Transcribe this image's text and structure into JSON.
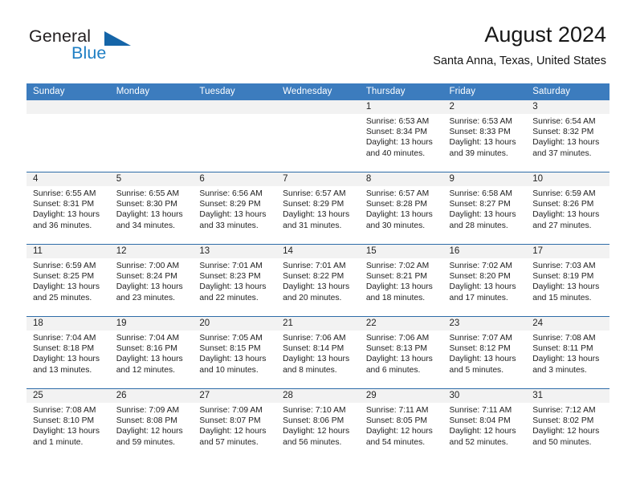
{
  "brand": {
    "name_part1": "General",
    "name_part2": "Blue",
    "triangle_color": "#1565a8",
    "blue_color": "#1f7fc4"
  },
  "header": {
    "title": "August 2024",
    "subtitle": "Santa Anna, Texas, United States"
  },
  "theme": {
    "header_row_bg": "#3c7cbe",
    "day_band_bg": "#f2f2f2",
    "row_divider": "#2e6ca8",
    "text": "#222222"
  },
  "weekdays": [
    "Sunday",
    "Monday",
    "Tuesday",
    "Wednesday",
    "Thursday",
    "Friday",
    "Saturday"
  ],
  "weeks": [
    [
      {
        "day": "",
        "sunrise": "",
        "sunset": "",
        "daylight_line1": "",
        "daylight_line2": ""
      },
      {
        "day": "",
        "sunrise": "",
        "sunset": "",
        "daylight_line1": "",
        "daylight_line2": ""
      },
      {
        "day": "",
        "sunrise": "",
        "sunset": "",
        "daylight_line1": "",
        "daylight_line2": ""
      },
      {
        "day": "",
        "sunrise": "",
        "sunset": "",
        "daylight_line1": "",
        "daylight_line2": ""
      },
      {
        "day": "1",
        "sunrise": "Sunrise: 6:53 AM",
        "sunset": "Sunset: 8:34 PM",
        "daylight_line1": "Daylight: 13 hours",
        "daylight_line2": "and 40 minutes."
      },
      {
        "day": "2",
        "sunrise": "Sunrise: 6:53 AM",
        "sunset": "Sunset: 8:33 PM",
        "daylight_line1": "Daylight: 13 hours",
        "daylight_line2": "and 39 minutes."
      },
      {
        "day": "3",
        "sunrise": "Sunrise: 6:54 AM",
        "sunset": "Sunset: 8:32 PM",
        "daylight_line1": "Daylight: 13 hours",
        "daylight_line2": "and 37 minutes."
      }
    ],
    [
      {
        "day": "4",
        "sunrise": "Sunrise: 6:55 AM",
        "sunset": "Sunset: 8:31 PM",
        "daylight_line1": "Daylight: 13 hours",
        "daylight_line2": "and 36 minutes."
      },
      {
        "day": "5",
        "sunrise": "Sunrise: 6:55 AM",
        "sunset": "Sunset: 8:30 PM",
        "daylight_line1": "Daylight: 13 hours",
        "daylight_line2": "and 34 minutes."
      },
      {
        "day": "6",
        "sunrise": "Sunrise: 6:56 AM",
        "sunset": "Sunset: 8:29 PM",
        "daylight_line1": "Daylight: 13 hours",
        "daylight_line2": "and 33 minutes."
      },
      {
        "day": "7",
        "sunrise": "Sunrise: 6:57 AM",
        "sunset": "Sunset: 8:29 PM",
        "daylight_line1": "Daylight: 13 hours",
        "daylight_line2": "and 31 minutes."
      },
      {
        "day": "8",
        "sunrise": "Sunrise: 6:57 AM",
        "sunset": "Sunset: 8:28 PM",
        "daylight_line1": "Daylight: 13 hours",
        "daylight_line2": "and 30 minutes."
      },
      {
        "day": "9",
        "sunrise": "Sunrise: 6:58 AM",
        "sunset": "Sunset: 8:27 PM",
        "daylight_line1": "Daylight: 13 hours",
        "daylight_line2": "and 28 minutes."
      },
      {
        "day": "10",
        "sunrise": "Sunrise: 6:59 AM",
        "sunset": "Sunset: 8:26 PM",
        "daylight_line1": "Daylight: 13 hours",
        "daylight_line2": "and 27 minutes."
      }
    ],
    [
      {
        "day": "11",
        "sunrise": "Sunrise: 6:59 AM",
        "sunset": "Sunset: 8:25 PM",
        "daylight_line1": "Daylight: 13 hours",
        "daylight_line2": "and 25 minutes."
      },
      {
        "day": "12",
        "sunrise": "Sunrise: 7:00 AM",
        "sunset": "Sunset: 8:24 PM",
        "daylight_line1": "Daylight: 13 hours",
        "daylight_line2": "and 23 minutes."
      },
      {
        "day": "13",
        "sunrise": "Sunrise: 7:01 AM",
        "sunset": "Sunset: 8:23 PM",
        "daylight_line1": "Daylight: 13 hours",
        "daylight_line2": "and 22 minutes."
      },
      {
        "day": "14",
        "sunrise": "Sunrise: 7:01 AM",
        "sunset": "Sunset: 8:22 PM",
        "daylight_line1": "Daylight: 13 hours",
        "daylight_line2": "and 20 minutes."
      },
      {
        "day": "15",
        "sunrise": "Sunrise: 7:02 AM",
        "sunset": "Sunset: 8:21 PM",
        "daylight_line1": "Daylight: 13 hours",
        "daylight_line2": "and 18 minutes."
      },
      {
        "day": "16",
        "sunrise": "Sunrise: 7:02 AM",
        "sunset": "Sunset: 8:20 PM",
        "daylight_line1": "Daylight: 13 hours",
        "daylight_line2": "and 17 minutes."
      },
      {
        "day": "17",
        "sunrise": "Sunrise: 7:03 AM",
        "sunset": "Sunset: 8:19 PM",
        "daylight_line1": "Daylight: 13 hours",
        "daylight_line2": "and 15 minutes."
      }
    ],
    [
      {
        "day": "18",
        "sunrise": "Sunrise: 7:04 AM",
        "sunset": "Sunset: 8:18 PM",
        "daylight_line1": "Daylight: 13 hours",
        "daylight_line2": "and 13 minutes."
      },
      {
        "day": "19",
        "sunrise": "Sunrise: 7:04 AM",
        "sunset": "Sunset: 8:16 PM",
        "daylight_line1": "Daylight: 13 hours",
        "daylight_line2": "and 12 minutes."
      },
      {
        "day": "20",
        "sunrise": "Sunrise: 7:05 AM",
        "sunset": "Sunset: 8:15 PM",
        "daylight_line1": "Daylight: 13 hours",
        "daylight_line2": "and 10 minutes."
      },
      {
        "day": "21",
        "sunrise": "Sunrise: 7:06 AM",
        "sunset": "Sunset: 8:14 PM",
        "daylight_line1": "Daylight: 13 hours",
        "daylight_line2": "and 8 minutes."
      },
      {
        "day": "22",
        "sunrise": "Sunrise: 7:06 AM",
        "sunset": "Sunset: 8:13 PM",
        "daylight_line1": "Daylight: 13 hours",
        "daylight_line2": "and 6 minutes."
      },
      {
        "day": "23",
        "sunrise": "Sunrise: 7:07 AM",
        "sunset": "Sunset: 8:12 PM",
        "daylight_line1": "Daylight: 13 hours",
        "daylight_line2": "and 5 minutes."
      },
      {
        "day": "24",
        "sunrise": "Sunrise: 7:08 AM",
        "sunset": "Sunset: 8:11 PM",
        "daylight_line1": "Daylight: 13 hours",
        "daylight_line2": "and 3 minutes."
      }
    ],
    [
      {
        "day": "25",
        "sunrise": "Sunrise: 7:08 AM",
        "sunset": "Sunset: 8:10 PM",
        "daylight_line1": "Daylight: 13 hours",
        "daylight_line2": "and 1 minute."
      },
      {
        "day": "26",
        "sunrise": "Sunrise: 7:09 AM",
        "sunset": "Sunset: 8:08 PM",
        "daylight_line1": "Daylight: 12 hours",
        "daylight_line2": "and 59 minutes."
      },
      {
        "day": "27",
        "sunrise": "Sunrise: 7:09 AM",
        "sunset": "Sunset: 8:07 PM",
        "daylight_line1": "Daylight: 12 hours",
        "daylight_line2": "and 57 minutes."
      },
      {
        "day": "28",
        "sunrise": "Sunrise: 7:10 AM",
        "sunset": "Sunset: 8:06 PM",
        "daylight_line1": "Daylight: 12 hours",
        "daylight_line2": "and 56 minutes."
      },
      {
        "day": "29",
        "sunrise": "Sunrise: 7:11 AM",
        "sunset": "Sunset: 8:05 PM",
        "daylight_line1": "Daylight: 12 hours",
        "daylight_line2": "and 54 minutes."
      },
      {
        "day": "30",
        "sunrise": "Sunrise: 7:11 AM",
        "sunset": "Sunset: 8:04 PM",
        "daylight_line1": "Daylight: 12 hours",
        "daylight_line2": "and 52 minutes."
      },
      {
        "day": "31",
        "sunrise": "Sunrise: 7:12 AM",
        "sunset": "Sunset: 8:02 PM",
        "daylight_line1": "Daylight: 12 hours",
        "daylight_line2": "and 50 minutes."
      }
    ]
  ]
}
